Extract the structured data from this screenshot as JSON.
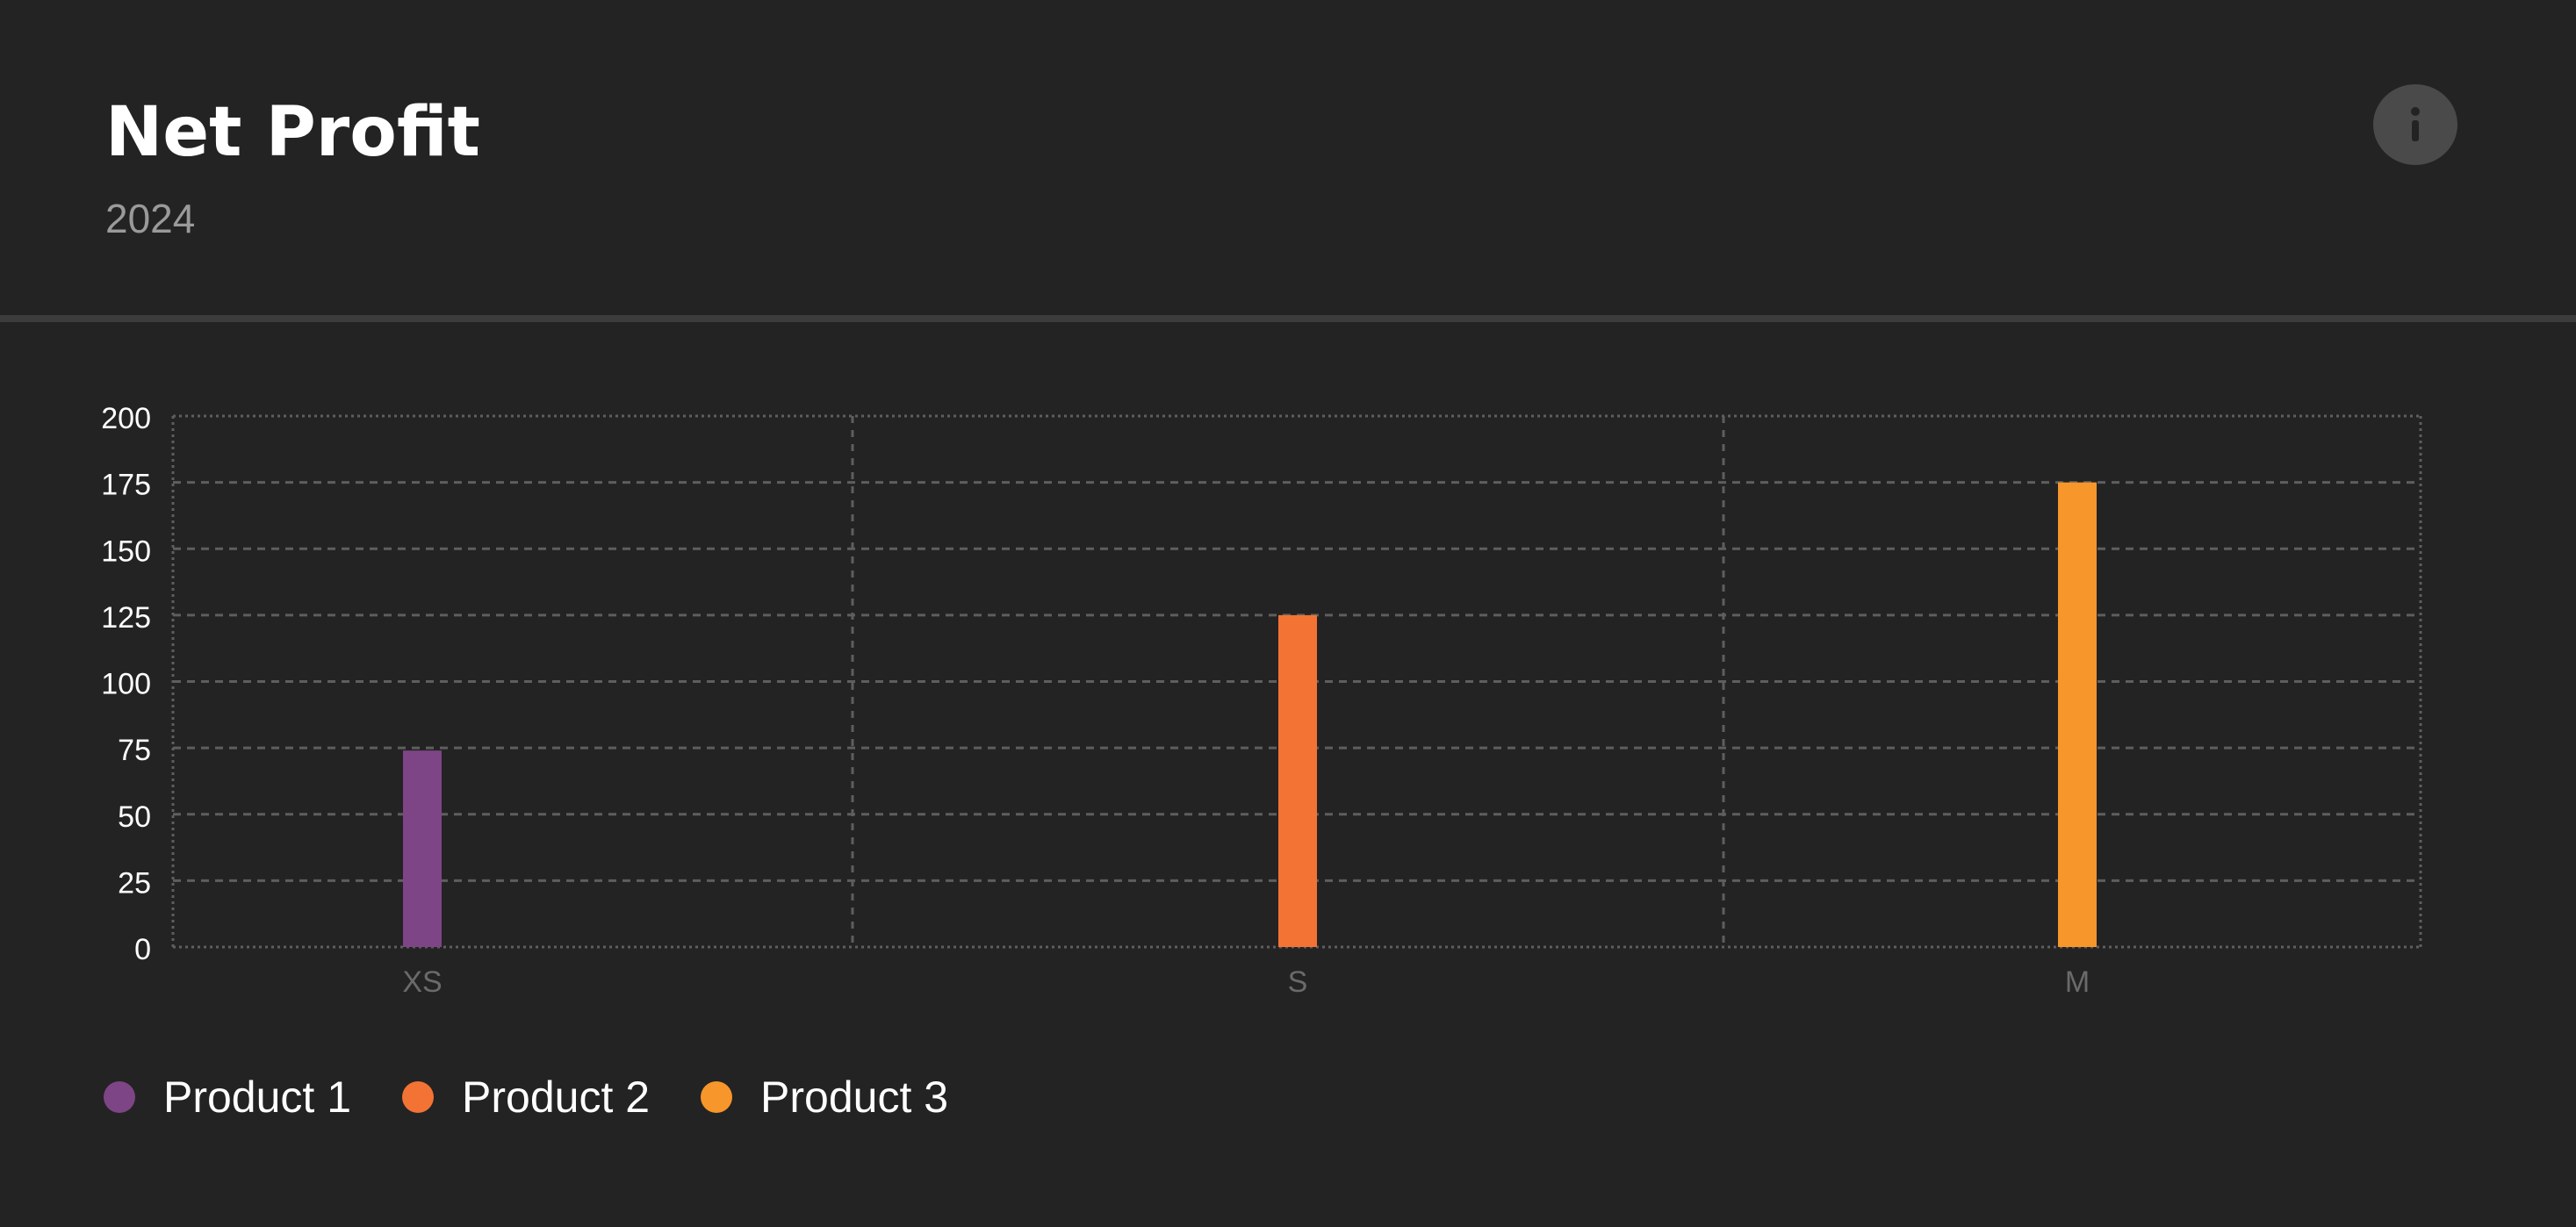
{
  "header": {
    "title": "Net Profit",
    "subtitle": "2024",
    "info_icon": "info-icon"
  },
  "colors": {
    "background": "#232323",
    "product1": "#7e4586",
    "product2": "#f37335",
    "product3": "#f7962a",
    "grid": "#5e5e5e",
    "tick_label_y": "#ffffff",
    "tick_label_x": "#6a6a6a"
  },
  "chart_data": {
    "type": "bar",
    "title": "Net Profit",
    "subtitle": "2024",
    "categories": [
      "XS",
      "S",
      "M"
    ],
    "series": [
      {
        "name": "Product 1",
        "color": "#7e4586",
        "values": [
          74,
          null,
          null
        ]
      },
      {
        "name": "Product 2",
        "color": "#f37335",
        "values": [
          null,
          125,
          null
        ]
      },
      {
        "name": "Product 3",
        "color": "#f7962a",
        "values": [
          null,
          null,
          175
        ]
      }
    ],
    "ylim": [
      0,
      200
    ],
    "yticks": [
      0,
      25,
      50,
      75,
      100,
      125,
      150,
      175,
      200
    ],
    "grid": true,
    "legend": "bottom-left",
    "xlabel": "",
    "ylabel": ""
  },
  "legend": {
    "items": [
      {
        "label": "Product 1",
        "color": "#7e4586"
      },
      {
        "label": "Product 2",
        "color": "#f37335"
      },
      {
        "label": "Product 3",
        "color": "#f7962a"
      }
    ]
  }
}
